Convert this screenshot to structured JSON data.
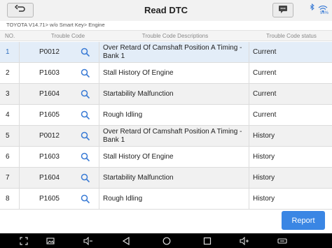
{
  "header": {
    "title": "Read DTC",
    "battery": "94%"
  },
  "breadcrumb": "TOYOTA V14.71> w/o Smart Key> Engine",
  "table": {
    "columns": [
      "NO.",
      "Trouble Code",
      "Trouble Code Descriptions",
      "Trouble Code status"
    ],
    "rows": [
      {
        "no": "1",
        "code": "P0012",
        "desc": "Over Retard Of Camshaft Position A Timing - Bank 1",
        "status": "Current"
      },
      {
        "no": "2",
        "code": "P1603",
        "desc": "Stall History Of Engine",
        "status": "Current"
      },
      {
        "no": "3",
        "code": "P1604",
        "desc": "Startability Malfunction",
        "status": "Current"
      },
      {
        "no": "4",
        "code": "P1605",
        "desc": "Rough Idling",
        "status": "Current"
      },
      {
        "no": "5",
        "code": "P0012",
        "desc": "Over Retard Of Camshaft Position A Timing - Bank 1",
        "status": "History"
      },
      {
        "no": "6",
        "code": "P1603",
        "desc": "Stall History Of Engine",
        "status": "History"
      },
      {
        "no": "7",
        "code": "P1604",
        "desc": "Startability Malfunction",
        "status": "History"
      },
      {
        "no": "8",
        "code": "P1605",
        "desc": "Rough Idling",
        "status": "History"
      }
    ],
    "selected_row": 0
  },
  "actions": {
    "report_label": "Report"
  },
  "colors": {
    "accent": "#3a86e4",
    "selected_row": "#e3edf8",
    "search_icon": "#3a7bd5"
  },
  "icons": {
    "back": "back-arrow-icon",
    "chat": "chat-icon",
    "bluetooth": "bluetooth-icon",
    "wifi": "wifi-icon",
    "search": "search-icon",
    "nav": [
      "screenshot-icon",
      "image-icon",
      "volume-down-icon",
      "back-icon",
      "home-icon",
      "recent-apps-icon",
      "volume-up-icon",
      "vci-icon"
    ]
  }
}
